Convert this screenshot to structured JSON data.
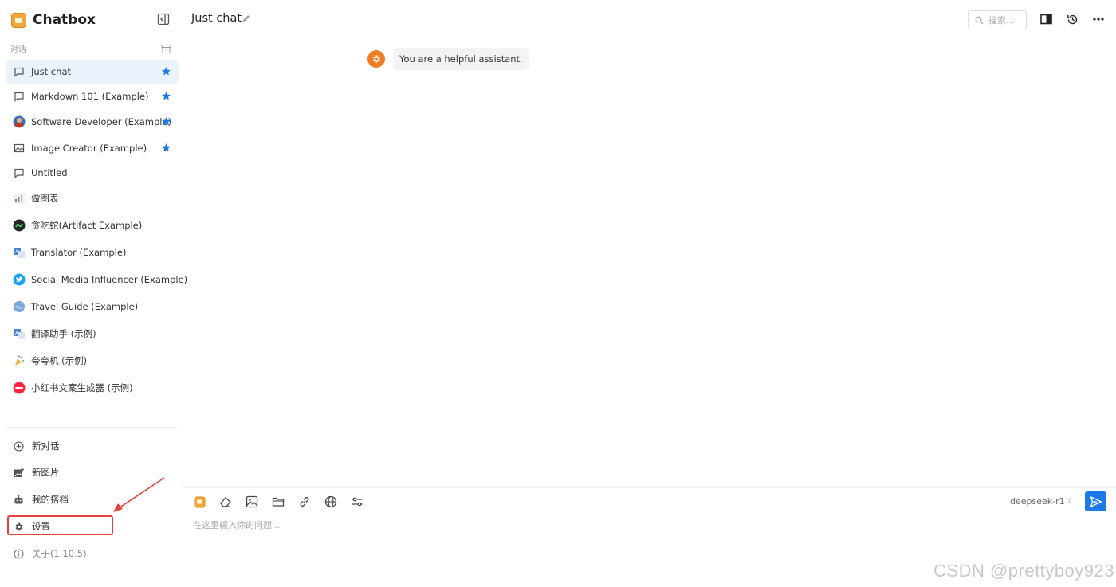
{
  "app": {
    "name": "Chatbox"
  },
  "sidebar": {
    "section_label": "对话",
    "conversations": [
      {
        "label": "Just chat",
        "icon": "chat-bubble-icon",
        "starred": true,
        "active": true
      },
      {
        "label": "Markdown 101 (Example)",
        "icon": "chat-bubble-icon",
        "starred": true
      },
      {
        "label": "Software Developer (Example)",
        "icon": "developer-avatar-icon",
        "starred": true
      },
      {
        "label": "Image Creator (Example)",
        "icon": "image-icon",
        "starred": true
      },
      {
        "label": "Untitled",
        "icon": "chat-bubble-icon",
        "starred": false
      },
      {
        "label": "做图表",
        "icon": "chart-avatar-icon",
        "starred": false
      },
      {
        "label": "贪吃蛇(Artifact Example)",
        "icon": "snake-avatar-icon",
        "starred": false
      },
      {
        "label": "Translator (Example)",
        "icon": "translator-avatar-icon",
        "starred": false
      },
      {
        "label": "Social Media Influencer (Example)",
        "icon": "twitter-avatar-icon",
        "starred": false
      },
      {
        "label": "Travel Guide (Example)",
        "icon": "globe-avatar-icon",
        "starred": false
      },
      {
        "label": "翻译助手 (示例)",
        "icon": "translator-avatar-icon",
        "starred": false
      },
      {
        "label": "夸夸机 (示例)",
        "icon": "party-avatar-icon",
        "starred": false
      },
      {
        "label": "小红书文案生成器 (示例)",
        "icon": "xiaohongshu-avatar-icon",
        "starred": false
      }
    ],
    "bottom": {
      "new_chat": "新对话",
      "new_image": "新图片",
      "my_copilots": "我的搭档",
      "settings": "设置",
      "about": "关于(1.10.5)"
    }
  },
  "header": {
    "title": "Just chat",
    "search_placeholder": "搜索..."
  },
  "messages": [
    {
      "role": "system",
      "text": "You are a helpful assistant."
    }
  ],
  "input": {
    "placeholder": "在这里输入你的问题...",
    "model": "deepseek-r1"
  },
  "watermark": "CSDN @prettyboy923",
  "colors": {
    "accent": "#1e7ae6",
    "active_bg": "#eaf2fb",
    "system_avatar": "#f07d24",
    "annotation": "#e0423a"
  }
}
